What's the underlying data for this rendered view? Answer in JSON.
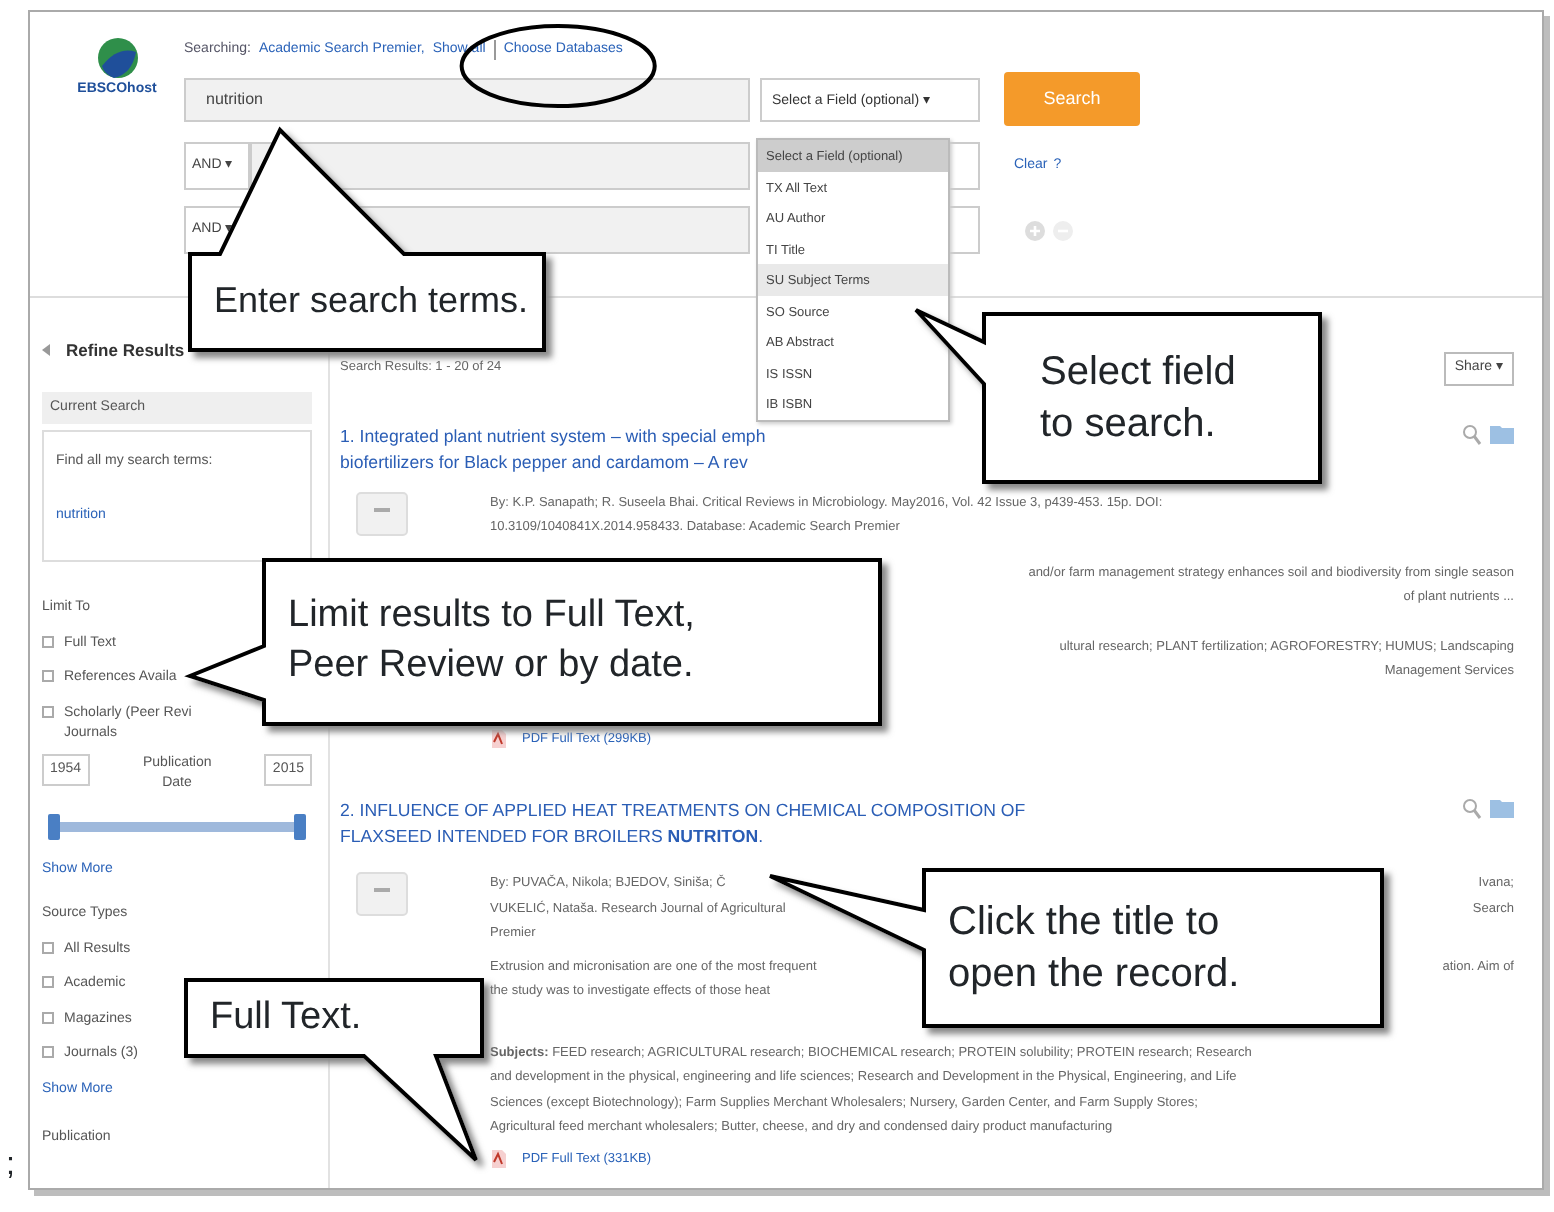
{
  "header": {
    "logo": "EBSCOhost",
    "searching_label": "Searching:",
    "database": "Academic Search Premier,",
    "show_all": "Show all",
    "choose_databases": "Choose Databases",
    "rows": [
      {
        "kind": "first",
        "value": "nutrition",
        "field": "Select a Field (optional) ▾"
      },
      {
        "kind": "added",
        "operator": "AND ▾"
      },
      {
        "kind": "added",
        "operator": "AND ▾"
      }
    ],
    "search_button": "Search",
    "clear": "Clear",
    "help": "?"
  },
  "field_menu": {
    "items": [
      {
        "label": "Select a Field (optional)",
        "selected": true,
        "hovered": false
      },
      {
        "label": "TX All Text",
        "selected": false,
        "hovered": false
      },
      {
        "label": "AU Author",
        "selected": false,
        "hovered": false
      },
      {
        "label": "TI Title",
        "selected": false,
        "hovered": false
      },
      {
        "label": "SU Subject Terms",
        "selected": false,
        "hovered": true
      },
      {
        "label": "SO Source",
        "selected": false,
        "hovered": false
      },
      {
        "label": "AB Abstract",
        "selected": false,
        "hovered": false
      },
      {
        "label": "IS ISSN",
        "selected": false,
        "hovered": false
      },
      {
        "label": "IB ISBN",
        "selected": false,
        "hovered": false
      }
    ]
  },
  "sidebar": {
    "title": "Refine Results",
    "current_heading": "Current Search",
    "current_label": "Find all my search terms:",
    "current_term": "nutrition",
    "limit_heading": "Limit To",
    "limit_options": [
      {
        "label": "Full Text",
        "checked": false
      },
      {
        "label": "References Availa",
        "checked": false
      },
      {
        "label": "Scholarly (Peer Revi",
        "checked": false,
        "second_line": "Journals"
      }
    ],
    "date_from": "1954",
    "date_label": "Publication Date",
    "date_to": "2015",
    "date_range": {
      "level": 1
    },
    "show_more": "Show More",
    "source_heading": "Source Types",
    "source_options": [
      {
        "label": "All Results",
        "checked": false
      },
      {
        "label": "Academic",
        "checked": false
      },
      {
        "label": "Magazines",
        "checked": false
      },
      {
        "label": "Journals (3)",
        "checked": false
      }
    ],
    "show_more_2": "Show More",
    "publication_heading": "Publication"
  },
  "results": {
    "count": "Search Results: 1 - 20 of 24",
    "share": "Share ▾",
    "items": [
      {
        "title_lines": [
          "1. Integrated plant nutrient system – with special emph",
          "biofertilizers for Black pepper and cardamom – A rev"
        ],
        "meta_lines": [
          {
            "left": "By: K.P. Sanapath; R. Suseela Bhai. Critical Reviews in Microbiology. May2016, Vol. 42 Issue 3, p439-453. 15p. DOI:"
          },
          {
            "left": "10.3109/1040841X.2014.958433. Database: Academic Search Premier"
          }
        ],
        "abstract_lines": [
          {
            "right": "and/or farm management strategy enhances soil and biodiversity from single season"
          },
          {
            "right": "of plant nutrients ..."
          }
        ],
        "subject_lines": [
          {
            "right": "ultural research; PLANT fertilization; AGROFORESTRY; HUMUS; Landscaping"
          },
          {
            "right": "Management Services"
          }
        ],
        "pdf": "PDF Full Text (299KB)"
      },
      {
        "title_lines": [
          "2. INFLUENCE OF APPLIED HEAT TREATMENTS ON CHEMICAL COMPOSITION OF",
          "FLAXSEED INTENDED FOR BROILERS **NUTRITON**."
        ],
        "meta_lines": [
          {
            "left": "By: PUVAČA, Nikola; BJEDOV, Siniša; Č",
            "right": "Ivana;"
          },
          {
            "left": "VUKELIĆ, Nataša. Research Journal of Agricultural",
            "right": "Search"
          },
          {
            "left": "Premier"
          }
        ],
        "abstract_lines": [
          {
            "left": "Extrusion and micronisation are one of the most frequent",
            "right": "ation. Aim of"
          },
          {
            "left": "the study was to investigate effects of those heat"
          }
        ],
        "subject_lines": [
          {
            "left": "**Subjects:** FEED research; AGRICULTURAL research; BIOCHEMICAL research; PROTEIN solubility; PROTEIN research; Research"
          },
          {
            "left": "and development in the physical, engineering and life sciences; Research and Development in the Physical, Engineering, and Life"
          },
          {
            "left": "Sciences (except Biotechnology); Farm Supplies Merchant Wholesalers; Nursery, Garden Center, and Farm Supply Stores;"
          },
          {
            "left": "Agricultural feed merchant wholesalers; Butter, cheese, and dry and condensed dairy product manufacturing"
          }
        ],
        "pdf": "PDF Full Text (331KB)"
      }
    ]
  },
  "callouts": [
    {
      "lines": [
        "Enter search terms."
      ]
    },
    {
      "lines": [
        "Select field",
        "to search."
      ]
    },
    {
      "lines": [
        "Limit results to Full Text,",
        "Peer Review or by date."
      ]
    },
    {
      "lines": [
        "Click the title to",
        "open the record."
      ]
    },
    {
      "lines": [
        "Full Text."
      ]
    }
  ],
  "margin_note": ";"
}
